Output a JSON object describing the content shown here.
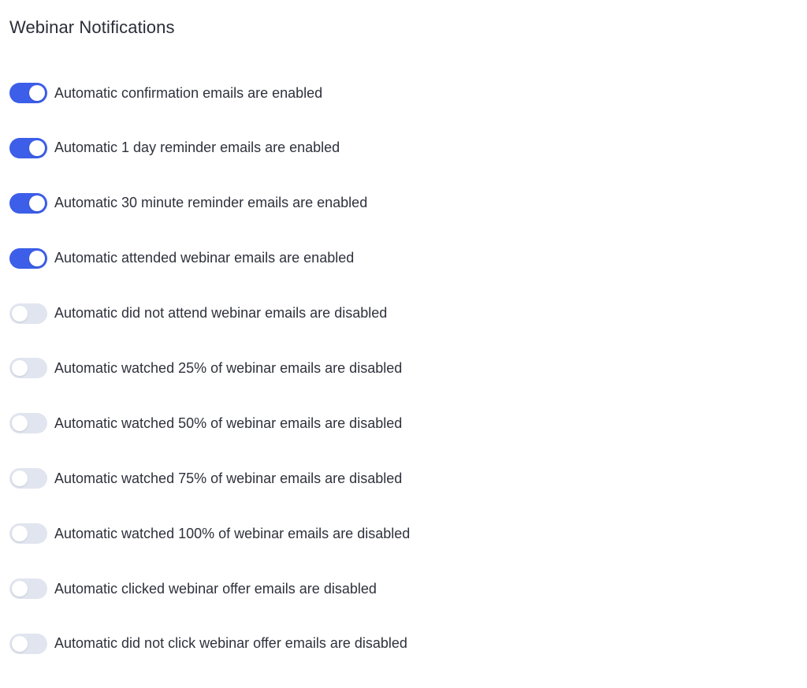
{
  "section": {
    "title": "Webinar Notifications"
  },
  "colors": {
    "toggle_on": "#3c5ee8",
    "toggle_off": "#e1e5ef",
    "text": "#2f313c"
  },
  "settings": [
    {
      "label": "Automatic confirmation emails are enabled",
      "enabled": true
    },
    {
      "label": "Automatic 1 day reminder emails are enabled",
      "enabled": true
    },
    {
      "label": "Automatic 30 minute reminder emails are enabled",
      "enabled": true
    },
    {
      "label": "Automatic attended webinar emails are enabled",
      "enabled": true
    },
    {
      "label": "Automatic did not attend webinar emails are disabled",
      "enabled": false
    },
    {
      "label": "Automatic watched 25% of webinar emails are disabled",
      "enabled": false
    },
    {
      "label": "Automatic watched 50% of webinar emails are disabled",
      "enabled": false
    },
    {
      "label": "Automatic watched 75% of webinar emails are disabled",
      "enabled": false
    },
    {
      "label": "Automatic watched 100% of webinar emails are disabled",
      "enabled": false
    },
    {
      "label": "Automatic clicked webinar offer emails are disabled",
      "enabled": false
    },
    {
      "label": "Automatic did not click webinar offer emails are disabled",
      "enabled": false
    }
  ]
}
